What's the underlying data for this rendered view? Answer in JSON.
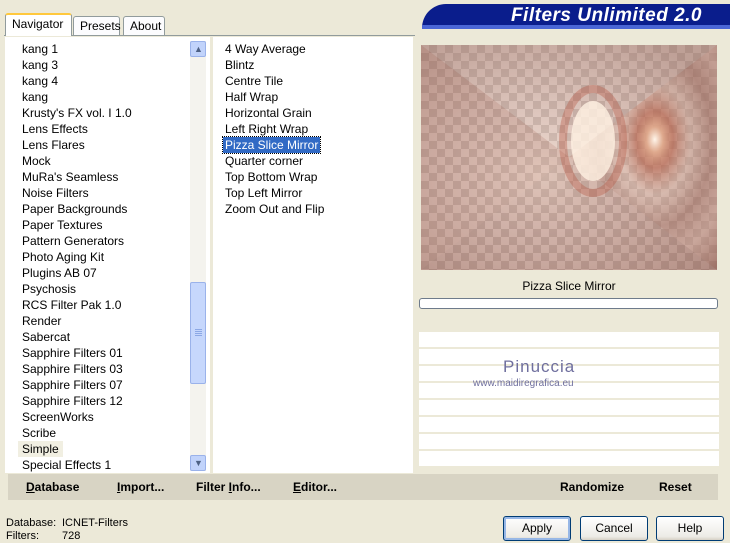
{
  "tabs": [
    {
      "label": "Navigator"
    },
    {
      "label": "Presets"
    },
    {
      "label": "About"
    }
  ],
  "banner_title": "Filters Unlimited 2.0",
  "categories": [
    "kang 1",
    "kang 3",
    "kang 4",
    "kang",
    "Krusty's FX vol. I 1.0",
    "Lens Effects",
    "Lens Flares",
    "Mock",
    "MuRa's Seamless",
    "Noise Filters",
    "Paper Backgrounds",
    "Paper Textures",
    "Pattern Generators",
    "Photo Aging Kit",
    "Plugins AB 07",
    "Psychosis",
    "RCS Filter Pak 1.0",
    "Render",
    "Sabercat",
    "Sapphire Filters 01",
    "Sapphire Filters 03",
    "Sapphire Filters 07",
    "Sapphire Filters 12",
    "ScreenWorks",
    "Scribe",
    "Simple",
    "Special Effects 1"
  ],
  "selected_category": "Simple",
  "filters": [
    "4 Way Average",
    "Blintz",
    "Centre Tile",
    "Half Wrap",
    "Horizontal Grain",
    "Left Right Wrap",
    "Pizza Slice Mirror",
    "Quarter corner",
    "Top Bottom Wrap",
    "Top Left Mirror",
    "Zoom Out and Flip"
  ],
  "selected_filter": "Pizza Slice Mirror",
  "preview": {
    "filter_name": "Pizza Slice Mirror",
    "progress_fraction": 0,
    "watermark_name": "Pinuccia",
    "watermark_url": "www.maidiregrafica.eu"
  },
  "toolbar": {
    "database": {
      "u": "D",
      "rest": "atabase"
    },
    "import": {
      "u": "I",
      "rest": "mport..."
    },
    "filter_info": {
      "pre": "Filter ",
      "u": "I",
      "rest": "nfo..."
    },
    "editor": {
      "u": "E",
      "rest": "ditor..."
    },
    "randomize": "Randomize",
    "reset": "Reset"
  },
  "status": {
    "database_label": "Database:",
    "database_value": "ICNET-Filters",
    "filters_label": "Filters:",
    "filters_value": "728"
  },
  "buttons": {
    "apply": "Apply",
    "cancel": "Cancel",
    "help": "Help"
  },
  "colors": {
    "banner": "#0a1d8c",
    "selection": "#316ac5",
    "window_bg": "#ece9d8"
  }
}
